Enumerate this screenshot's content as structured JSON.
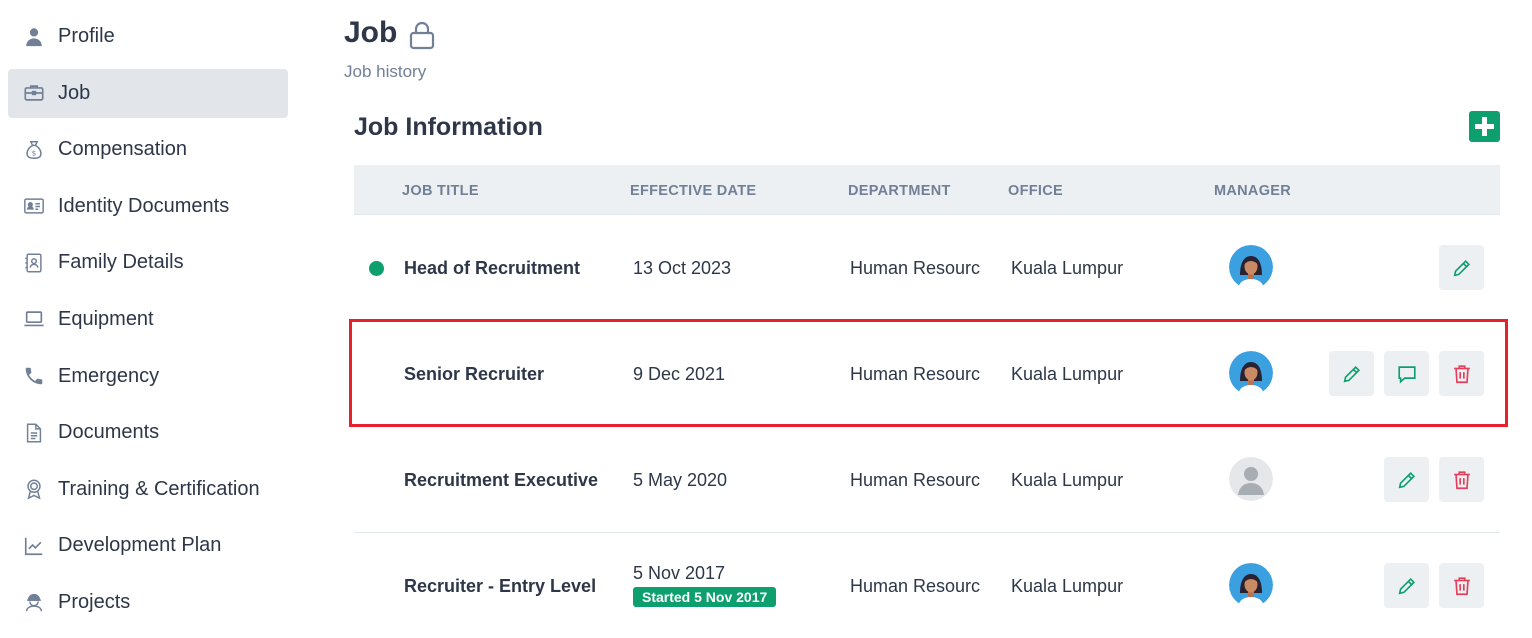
{
  "sidebar": {
    "items": [
      {
        "label": "Profile",
        "icon": "user-icon",
        "active": false
      },
      {
        "label": "Job",
        "icon": "briefcase-icon",
        "active": true
      },
      {
        "label": "Compensation",
        "icon": "money-bag-icon",
        "active": false
      },
      {
        "label": "Identity Documents",
        "icon": "id-card-icon",
        "active": false
      },
      {
        "label": "Family Details",
        "icon": "contact-book-icon",
        "active": false
      },
      {
        "label": "Equipment",
        "icon": "laptop-icon",
        "active": false
      },
      {
        "label": "Emergency",
        "icon": "phone-icon",
        "active": false
      },
      {
        "label": "Documents",
        "icon": "document-icon",
        "active": false
      },
      {
        "label": "Training & Certification",
        "icon": "award-icon",
        "active": false
      },
      {
        "label": "Development Plan",
        "icon": "chart-line-icon",
        "active": false
      },
      {
        "label": "Projects",
        "icon": "worker-icon",
        "active": false
      }
    ]
  },
  "header": {
    "title": "Job",
    "subtitle": "Job history"
  },
  "section": {
    "title": "Job Information"
  },
  "table": {
    "columns": [
      "JOB TITLE",
      "EFFECTIVE DATE",
      "DEPARTMENT",
      "OFFICE",
      "MANAGER"
    ],
    "rows": [
      {
        "current": true,
        "job_title": "Head of Recruitment",
        "effective_date": "13 Oct 2023",
        "badge": "",
        "department": "Human Resources",
        "office": "Kuala Lumpur",
        "manager_avatar": "female",
        "actions": [
          "edit"
        ]
      },
      {
        "current": false,
        "job_title": "Senior Recruiter",
        "effective_date": "9 Dec 2021",
        "badge": "",
        "department": "Human Resources",
        "office": "Kuala Lumpur",
        "manager_avatar": "female",
        "actions": [
          "edit",
          "comment",
          "delete"
        ]
      },
      {
        "current": false,
        "job_title": "Recruitment Executive",
        "effective_date": "5 May 2020",
        "badge": "",
        "department": "Human Resources",
        "office": "Kuala Lumpur",
        "manager_avatar": "placeholder",
        "actions": [
          "edit",
          "delete"
        ]
      },
      {
        "current": false,
        "job_title": "Recruiter - Entry Level",
        "effective_date": "5 Nov 2017",
        "badge": "Started 5 Nov 2017",
        "department": "Human Resources",
        "office": "Kuala Lumpur",
        "manager_avatar": "female",
        "actions": [
          "edit",
          "delete"
        ]
      }
    ]
  },
  "colors": {
    "accent_green": "#0e9f6e",
    "delete_red": "#e53e5a",
    "highlight_red": "#e8202b",
    "active_nav_bg": "#e2e6eb",
    "table_header_bg": "#edf0f3"
  }
}
